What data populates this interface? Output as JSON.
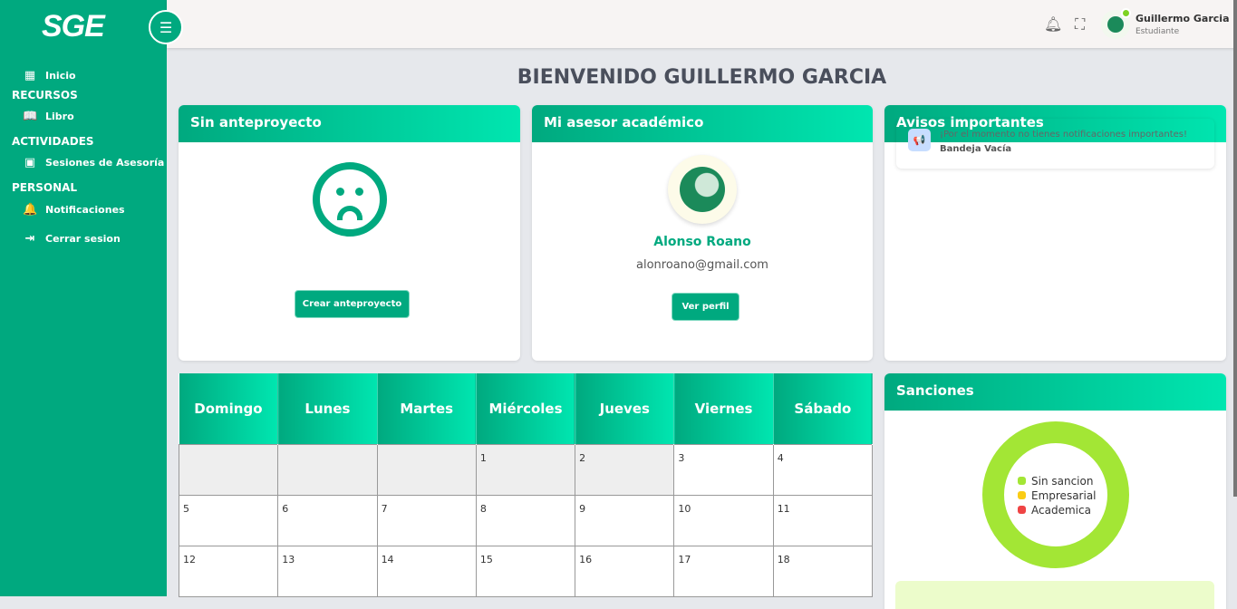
{
  "app": {
    "logo": "SGE"
  },
  "sidebar": {
    "items": [
      {
        "type": "item",
        "label": "Inicio",
        "icon": "dashboard-icon"
      },
      {
        "type": "section",
        "label": "RECURSOS"
      },
      {
        "type": "item",
        "label": "Libro",
        "icon": "book-icon"
      },
      {
        "type": "section",
        "label": "ACTIVIDADES"
      },
      {
        "type": "item",
        "label": "Sesiones de Asesoría",
        "icon": "calendar-icon"
      },
      {
        "type": "section",
        "label": "PERSONAL"
      },
      {
        "type": "item",
        "label": "Notificaciones",
        "icon": "bell-icon"
      },
      {
        "type": "item",
        "label": "Cerrar sesion",
        "icon": "logout-icon"
      }
    ]
  },
  "header": {
    "user_name": "Guillermo Garcia",
    "user_role": "Estudiante"
  },
  "page_title": "BIENVENIDO GUILLERMO GARCIA",
  "anteproyecto": {
    "title": "Sin anteproyecto",
    "button": "Crear anteproyecto"
  },
  "asesor": {
    "title": "Mi asesor académico",
    "name": "Alonso Roano",
    "email": "alonroano@gmail.com",
    "button": "Ver perfil"
  },
  "avisos": {
    "title": "Avisos importantes",
    "message": "¡Por el momento no tienes notificaciones importantes!",
    "status": "Bandeja Vacía"
  },
  "calendar": {
    "days": [
      "Domingo",
      "Lunes",
      "Martes",
      "Miércoles",
      "Jueves",
      "Viernes",
      "Sábado"
    ],
    "weeks": [
      [
        "",
        "",
        "",
        "1",
        "2",
        "3",
        "4"
      ],
      [
        "5",
        "6",
        "7",
        "8",
        "9",
        "10",
        "11"
      ],
      [
        "12",
        "13",
        "14",
        "15",
        "16",
        "17",
        "18"
      ]
    ]
  },
  "sanciones": {
    "title": "Sanciones"
  },
  "chart_data": {
    "type": "pie",
    "variant": "donut",
    "title": "Sanciones",
    "categories": [
      "Sin sancion",
      "Empresarial",
      "Academica"
    ],
    "values": [
      100,
      0,
      0
    ],
    "colors": [
      "#a3e635",
      "#facc15",
      "#ef4444"
    ],
    "legend": "center"
  }
}
